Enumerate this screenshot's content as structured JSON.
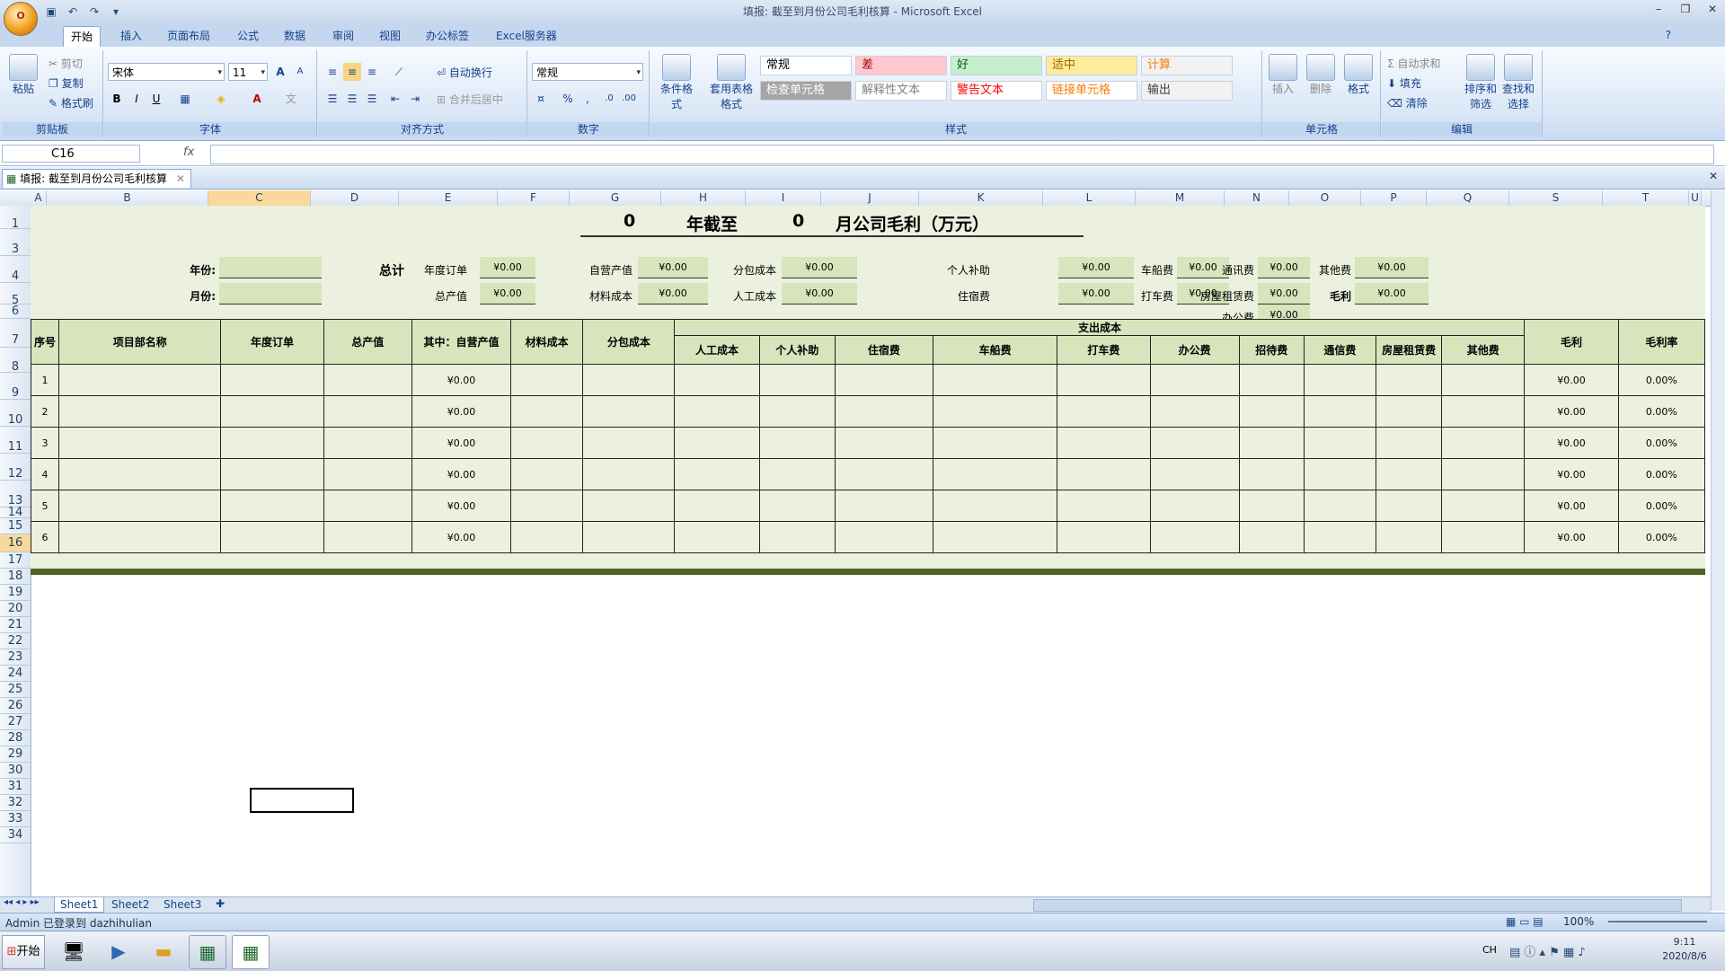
{
  "window": {
    "title": "填报: 截至到月份公司毛利核算 - Microsoft Excel"
  },
  "office_button": "O",
  "ribbon_tabs": [
    "开始",
    "插入",
    "页面布局",
    "公式",
    "数据",
    "审阅",
    "视图",
    "办公标签",
    "Excel服务器"
  ],
  "clipboard": {
    "paste": "粘贴",
    "cut": "剪切",
    "copy": "复制",
    "format_painter": "格式刷",
    "label": "剪贴板"
  },
  "font": {
    "name": "宋体",
    "size": "11",
    "label": "字体"
  },
  "alignment": {
    "wrap": "自动换行",
    "merge": "合并后居中",
    "label": "对齐方式"
  },
  "number": {
    "format": "常规",
    "label": "数字"
  },
  "styles": {
    "cond_format": "条件格式",
    "table_format": "套用表格格式",
    "cells": [
      {
        "text": "常规",
        "bg": "#ffffff",
        "color": "#000000"
      },
      {
        "text": "差",
        "bg": "#ffc7ce",
        "color": "#9c0006"
      },
      {
        "text": "好",
        "bg": "#c6efce",
        "color": "#006100"
      },
      {
        "text": "适中",
        "bg": "#ffeb9c",
        "color": "#9c6500"
      },
      {
        "text": "计算",
        "bg": "#f2f2f2",
        "color": "#fa7d00"
      },
      {
        "text": "检查单元格",
        "bg": "#a5a5a5",
        "color": "#ffffff"
      },
      {
        "text": "解释性文本",
        "bg": "#ffffff",
        "color": "#7f7f7f"
      },
      {
        "text": "警告文本",
        "bg": "#ffffff",
        "color": "#ff0000"
      },
      {
        "text": "链接单元格",
        "bg": "#ffffff",
        "color": "#fa7d00"
      },
      {
        "text": "输出",
        "bg": "#f2f2f2",
        "color": "#3f3f3f"
      }
    ],
    "label": "样式"
  },
  "cells_group": {
    "insert": "插入",
    "delete": "删除",
    "format": "格式",
    "label": "单元格"
  },
  "editing": {
    "autosum": "自动求和",
    "fill": "填充",
    "clear": "清除",
    "sort": "排序和筛选",
    "find": "查找和选择",
    "label": "编辑"
  },
  "formula_bar": {
    "name_box": "C16",
    "fx": "fx"
  },
  "workbook_tab": "填报: 截至到月份公司毛利核算",
  "columns": [
    "A",
    "B",
    "C",
    "D",
    "E",
    "F",
    "G",
    "H",
    "I",
    "J",
    "K",
    "L",
    "M",
    "N",
    "O",
    "P",
    "Q",
    "S",
    "T",
    "U"
  ],
  "rows": [
    "1",
    "3",
    "4",
    "5",
    "6",
    "7",
    "8",
    "9",
    "10",
    "11",
    "12",
    "13",
    "14",
    "15",
    "16",
    "17",
    "18",
    "19",
    "20",
    "21",
    "22",
    "23",
    "24",
    "25",
    "26",
    "27",
    "28",
    "29",
    "30",
    "31",
    "32",
    "33",
    "34"
  ],
  "sheet": {
    "title_year": "0",
    "title_mid": "年截至",
    "title_month": "0",
    "title_end": "月公司毛利（万元）",
    "year_label": "年份:",
    "month_label": "月份:",
    "total_label": "总计",
    "summary": [
      {
        "label": "年度订单",
        "value": "¥0.00"
      },
      {
        "label": "总产值",
        "value": "¥0.00"
      },
      {
        "label": "自营产值",
        "value": "¥0.00"
      },
      {
        "label": "材料成本",
        "value": "¥0.00"
      },
      {
        "label": "分包成本",
        "value": "¥0.00"
      },
      {
        "label": "人工成本",
        "value": "¥0.00"
      },
      {
        "label": "个人补助",
        "value": "¥0.00"
      },
      {
        "label": "住宿费",
        "value": "¥0.00"
      },
      {
        "label": "车船费",
        "value": "¥0.00"
      },
      {
        "label": "打车费",
        "value": "¥0.00"
      },
      {
        "label": "通讯费",
        "value": "¥0.00"
      },
      {
        "label": "房屋租赁费",
        "value": "¥0.00"
      },
      {
        "label": "办公费",
        "value": "¥0.00"
      },
      {
        "label": "其他费",
        "value": "¥0.00"
      },
      {
        "label": "毛利",
        "value": "¥0.00"
      }
    ],
    "headers": {
      "seq": "序号",
      "project": "项目部名称",
      "annual_order": "年度订单",
      "total_output": "总产值",
      "self_output": "其中：自营产值",
      "material": "材料成本",
      "subcontract": "分包成本",
      "expense": "支出成本",
      "labor": "人工成本",
      "allowance": "个人补助",
      "lodging": "住宿费",
      "vehicle": "车船费",
      "taxi": "打车费",
      "office": "办公费",
      "hospitality": "招待费",
      "comm": "通信费",
      "rent": "房屋租赁费",
      "other": "其他费",
      "profit": "毛利",
      "rate": "毛利率"
    },
    "rows": [
      {
        "seq": "1",
        "self_output": "¥0.00",
        "profit": "¥0.00",
        "rate": "0.00%"
      },
      {
        "seq": "2",
        "self_output": "¥0.00",
        "profit": "¥0.00",
        "rate": "0.00%"
      },
      {
        "seq": "3",
        "self_output": "¥0.00",
        "profit": "¥0.00",
        "rate": "0.00%"
      },
      {
        "seq": "4",
        "self_output": "¥0.00",
        "profit": "¥0.00",
        "rate": "0.00%"
      },
      {
        "seq": "5",
        "self_output": "¥0.00",
        "profit": "¥0.00",
        "rate": "0.00%"
      },
      {
        "seq": "6",
        "self_output": "¥0.00",
        "profit": "¥0.00",
        "rate": "0.00%"
      }
    ]
  },
  "sheet_tabs": [
    "Sheet1",
    "Sheet2",
    "Sheet3"
  ],
  "status": {
    "text": "Admin 已登录到 dazhihulian",
    "zoom": "100%"
  },
  "taskbar": {
    "start": "开始",
    "lang": "CH",
    "time": "9:11",
    "date": "2020/8/6"
  }
}
